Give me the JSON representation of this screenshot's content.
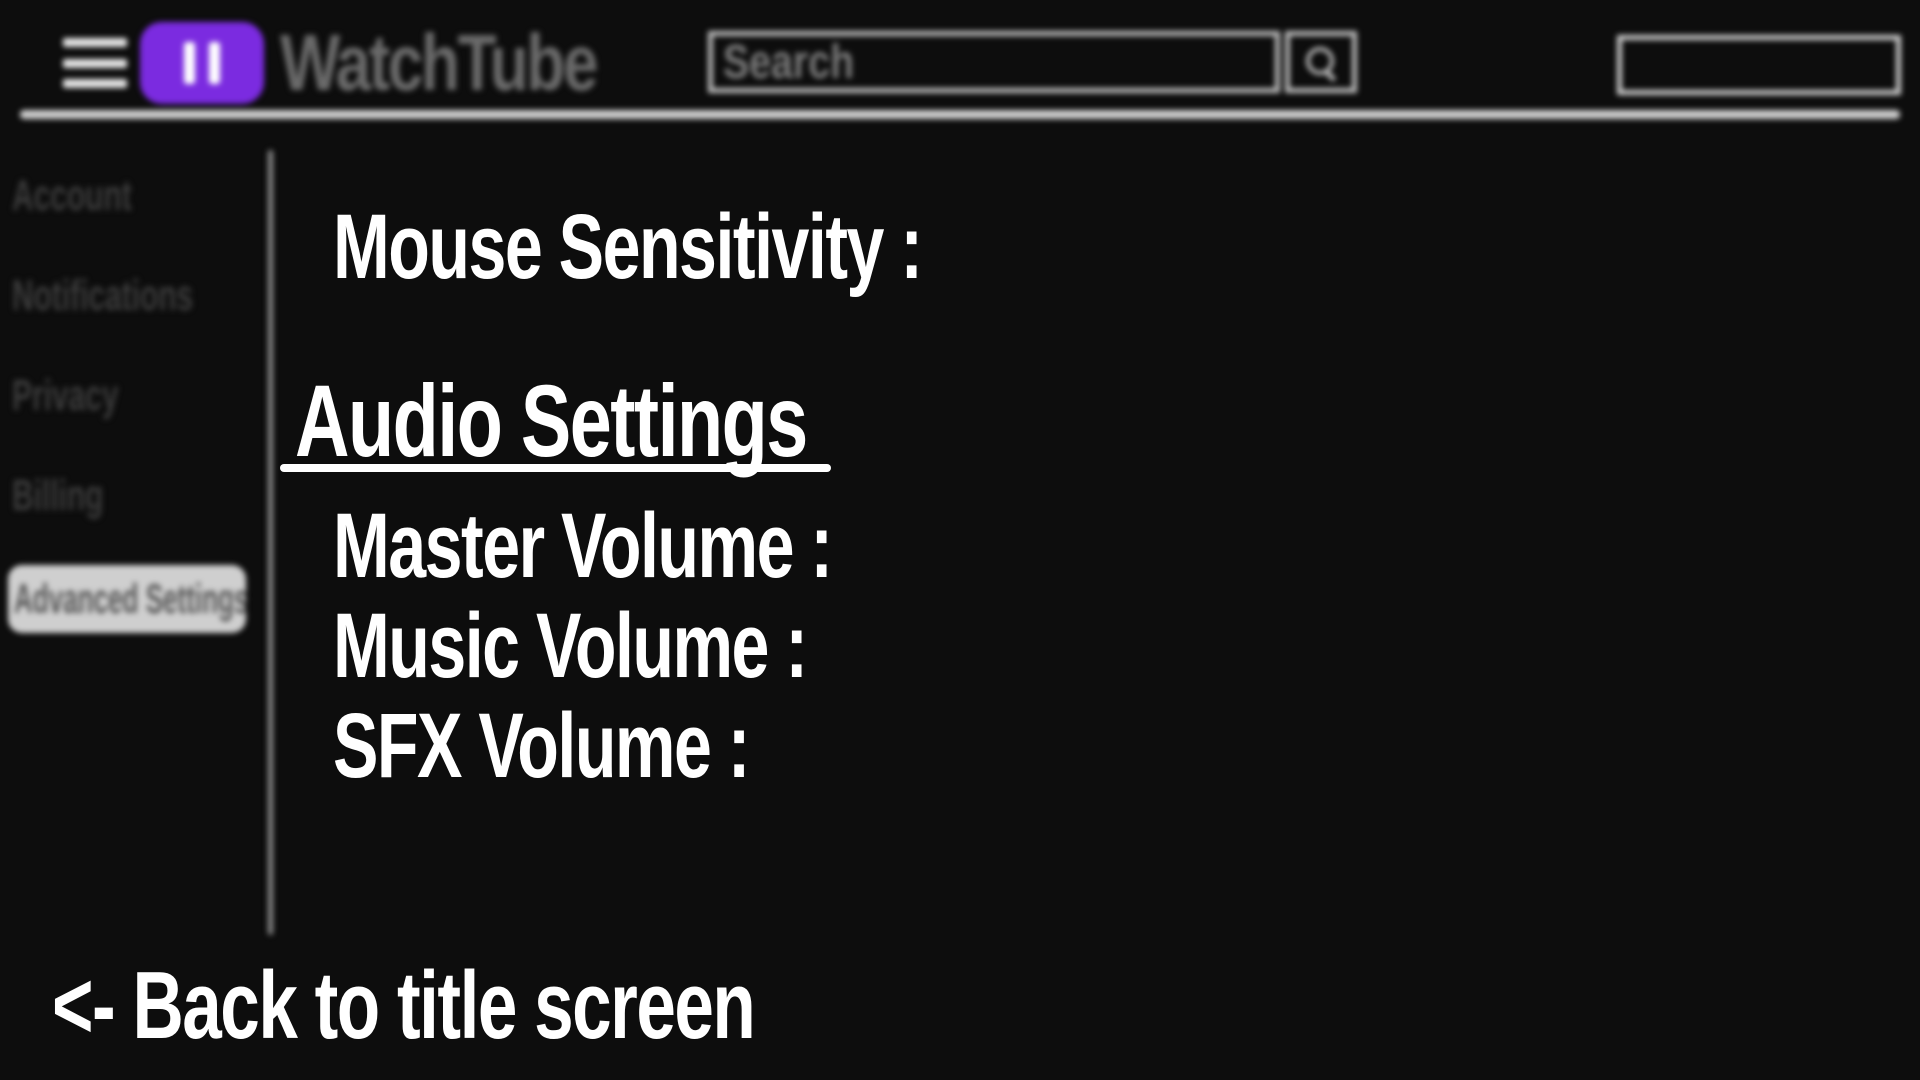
{
  "app": {
    "name": "WatchTube"
  },
  "header": {
    "search_placeholder": "Search"
  },
  "sidebar": {
    "items": [
      {
        "label": "Account"
      },
      {
        "label": "Notifications"
      },
      {
        "label": "Privacy"
      },
      {
        "label": "Billing"
      },
      {
        "label": "Advanced Settings",
        "active": true
      }
    ]
  },
  "settings": {
    "mouse_sensitivity_label": "Mouse Sensitivity :",
    "audio_heading": "Audio Settings",
    "master_volume_label": "Master Volume :",
    "music_volume_label": "Music Volume :",
    "sfx_volume_label": "SFX Volume :"
  },
  "footer": {
    "back_label": "<- Back to title screen"
  },
  "colors": {
    "background": "#0d0d0d",
    "logo_accent": "#7b2be0",
    "text": "#ffffff"
  },
  "icons": {
    "menu": "hamburger-menu-icon",
    "logo": "pause-logo-icon",
    "search": "search-icon"
  }
}
